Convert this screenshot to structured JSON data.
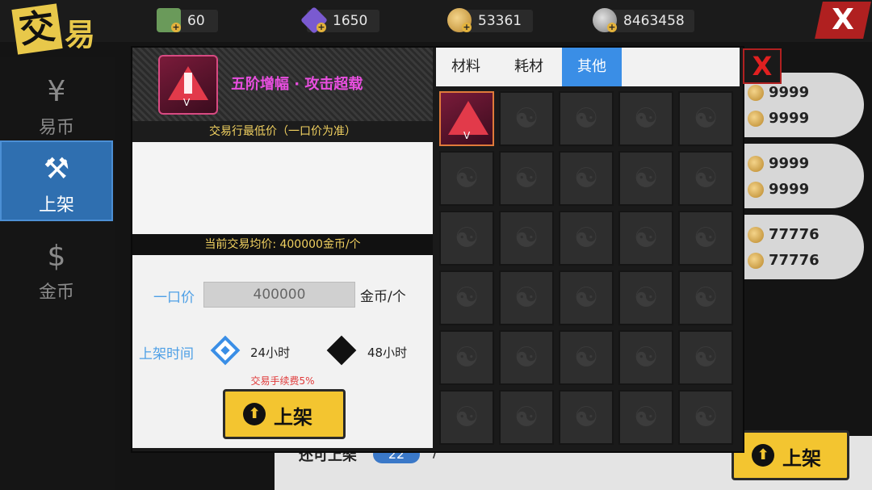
{
  "header": {
    "title_char1": "交",
    "title_char2": "易",
    "resources": [
      {
        "icon": "cash-icon",
        "value": "60",
        "color": "#6a9a5a"
      },
      {
        "icon": "crystal-icon",
        "value": "1650",
        "color": "#7a5ad0"
      },
      {
        "icon": "gold-coin-icon",
        "value": "53361",
        "color": "#d9a43a"
      },
      {
        "icon": "silver-coin-icon",
        "value": "8463458",
        "color": "#9a9a9a"
      }
    ],
    "close_label": "X"
  },
  "sidebar": {
    "items": [
      {
        "icon": "¥",
        "label": "易币",
        "active": false
      },
      {
        "icon": "⚒",
        "label": "上架",
        "active": true
      },
      {
        "icon": "$",
        "label": "金币",
        "active": false
      }
    ]
  },
  "background": {
    "pills": [
      {
        "row1": "9999",
        "row2": "9999"
      },
      {
        "row1": "9999",
        "row2": "9999"
      },
      {
        "row1": "77776",
        "row2": "77776"
      }
    ],
    "bottom_text": "还可上架",
    "bottom_count": "22",
    "bottom_sep": "/",
    "list_button": "上架"
  },
  "dialog": {
    "item_name": "五阶增幅 · 攻击超载",
    "item_grade": "V",
    "lowest_price_label": "交易行最低价（一口价为准）",
    "avg_price_label": "当前交易均价: 400000金币/个",
    "price_label": "一口价",
    "price_value": "400000",
    "price_unit": "金币/个",
    "duration_label": "上架时间",
    "duration_options": [
      {
        "label": "24小时",
        "selected": true
      },
      {
        "label": "48小时",
        "selected": false
      }
    ],
    "fee_text": "交易手续费5%",
    "submit_label": "上架",
    "tabs": [
      {
        "label": "材料",
        "active": false
      },
      {
        "label": "耗材",
        "active": false
      },
      {
        "label": "其他",
        "active": true
      }
    ],
    "close_label": "X",
    "inventory": {
      "columns": 5,
      "rows": 6,
      "filled_slots": [
        {
          "index": 0,
          "grade": "V"
        }
      ]
    }
  },
  "colors": {
    "accent_blue": "#3a8ee6",
    "gold": "#f3c530",
    "item_name": "#e94ee0",
    "close_red": "#b02020"
  }
}
